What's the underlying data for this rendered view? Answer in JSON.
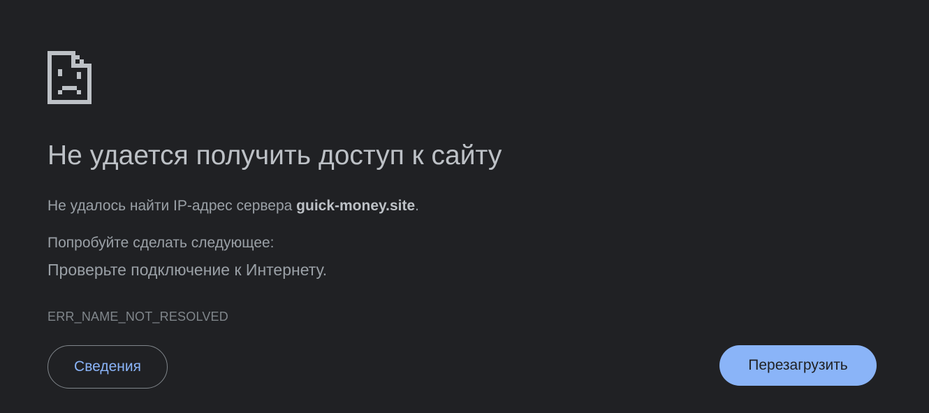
{
  "icon": {
    "name": "sad-document-icon",
    "color": "#bdc1c6"
  },
  "title": "Не удается получить доступ к сайту",
  "message": {
    "prefix": "Не удалось найти IP-адрес сервера ",
    "host": "guick-money.site",
    "suffix": "."
  },
  "suggestions": {
    "heading": "Попробуйте сделать следующее:",
    "items": [
      "Проверьте подключение к Интернету."
    ]
  },
  "error_code": "ERR_NAME_NOT_RESOLVED",
  "buttons": {
    "details_label": "Сведения",
    "reload_label": "Перезагрузить"
  },
  "colors": {
    "background": "#202124",
    "accent": "#8ab4f8",
    "text_primary": "#bdc1c6",
    "text_secondary": "#9aa0a6"
  }
}
